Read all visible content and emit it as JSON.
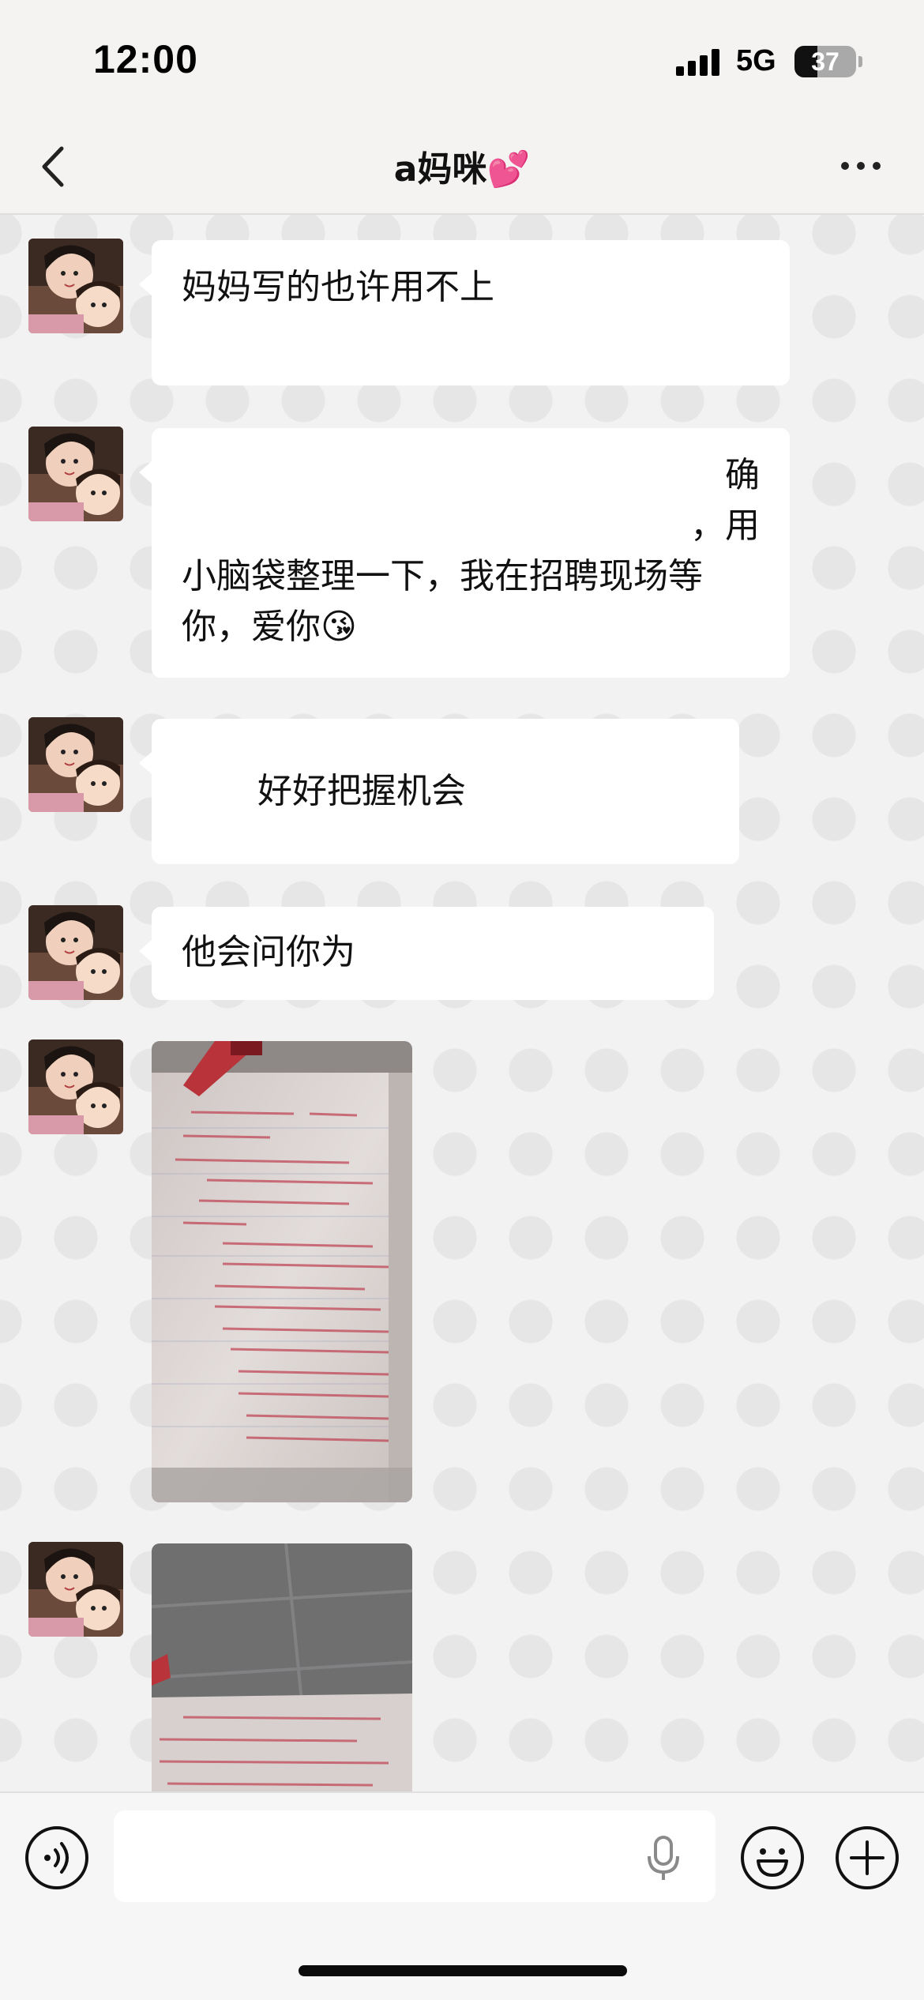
{
  "status_bar": {
    "time": "12:00",
    "network": "5G",
    "battery": "37",
    "battery_level": 0.37
  },
  "header": {
    "title": "a妈咪💕"
  },
  "messages": [
    {
      "type": "text",
      "lines": [
        "妈妈写的也许用不上"
      ]
    },
    {
      "type": "text",
      "lines": [
        "‌‌ ‌ ‌ ‌ ‌ ‌ ‌ ‌ ‌ ‌ ‌ ‌ ‌ ‌ 确",
        "‌ ‌ ‌ ‌ ‌ ‌ ‌ ‌ ‌ ‌ ‌ ‌ ‌ ，用",
        "小脑袋整理一下，我在招聘现场等",
        "你，爱你😘"
      ]
    },
    {
      "type": "text",
      "lines": [
        "",
        "好好把握机会"
      ]
    },
    {
      "type": "text",
      "lines": [
        "他会问你为"
      ]
    },
    {
      "type": "image",
      "alt": "photo-1"
    },
    {
      "type": "image",
      "alt": "photo-2"
    }
  ],
  "input": {
    "placeholder": ""
  },
  "colors": {
    "background": "#f2f2f2",
    "bubble": "#ffffff",
    "dot": "#e6e6e6",
    "ink_red": "#c04858"
  }
}
